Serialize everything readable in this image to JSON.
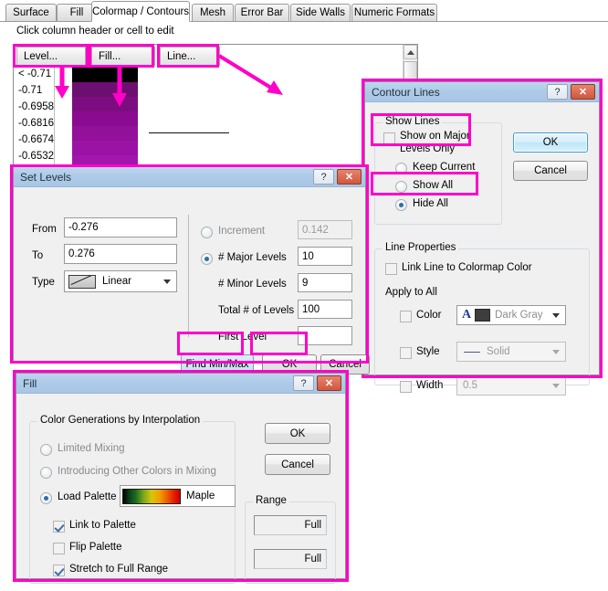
{
  "tabs": [
    {
      "label": "Surface",
      "active": false
    },
    {
      "label": "Fill",
      "active": false
    },
    {
      "label": "Colormap / Contours",
      "active": true
    },
    {
      "label": "Mesh",
      "active": false
    },
    {
      "label": "Error Bar",
      "active": false
    },
    {
      "label": "Side Walls",
      "active": false
    },
    {
      "label": "Numeric Formats",
      "active": false
    }
  ],
  "panel": {
    "hint": "Click column header or cell to edit",
    "columns": [
      "Level...",
      "Fill...",
      "Line..."
    ],
    "levels": [
      "< -0.71",
      "-0.71",
      "-0.6958",
      "-0.6816",
      "-0.6674",
      "-0.6532"
    ]
  },
  "set_levels": {
    "title": "Set Levels",
    "help_label": "?",
    "close_label": "✕",
    "from_label": "From",
    "from_value": "-0.276",
    "to_label": "To",
    "to_value": "0.276",
    "type_label": "Type",
    "type_value": "Linear",
    "increment_label": "Increment",
    "increment_value": "0.142",
    "major_levels_label": "# Major Levels",
    "major_levels_value": "10",
    "minor_levels_label": "# Minor Levels",
    "minor_levels_value": "9",
    "total_levels_label": "Total # of Levels",
    "total_levels_value": "100",
    "first_level_label": "First Level",
    "first_level_value": "",
    "find_minmax_label": "Find Min/Max",
    "ok_label": "OK",
    "cancel_label": "Cancel"
  },
  "contour_lines": {
    "title": "Contour Lines",
    "help_label": "?",
    "close_label": "✕",
    "ok_label": "OK",
    "cancel_label": "Cancel",
    "show_lines_group": "Show Lines",
    "show_major_only_label": "Show on Major\nLevels Only",
    "show_major_only_line1": "Show on Major",
    "show_major_only_line2": "Levels Only",
    "keep_current_label": "Keep Current",
    "show_all_label": "Show All",
    "hide_all_label": "Hide All",
    "line_properties_group": "Line Properties",
    "link_line_label": "Link Line to Colormap Color",
    "apply_to_all_label": "Apply to All",
    "color_label": "Color",
    "color_value": "Dark Gray",
    "style_label": "Style",
    "style_value": "Solid",
    "width_label": "Width",
    "width_value": "0.5"
  },
  "fill": {
    "title": "Fill",
    "help_label": "?",
    "close_label": "✕",
    "group_label": "Color Generations by Interpolation",
    "limited_mixing_label": "Limited Mixing",
    "introducing_label": "Introducing Other Colors in Mixing",
    "load_palette_label": "Load Palette",
    "palette_value": "Maple",
    "link_to_palette_label": "Link to Palette",
    "flip_palette_label": "Flip Palette",
    "stretch_label": "Stretch to Full Range",
    "range_group": "Range",
    "range_value_1": "Full",
    "range_value_2": "Full",
    "ok_label": "OK",
    "cancel_label": "Cancel"
  },
  "colors": {
    "accent": "#ff00c8",
    "title_bar": "#aecbe8",
    "dialog_bg": "#f0f0f0"
  }
}
